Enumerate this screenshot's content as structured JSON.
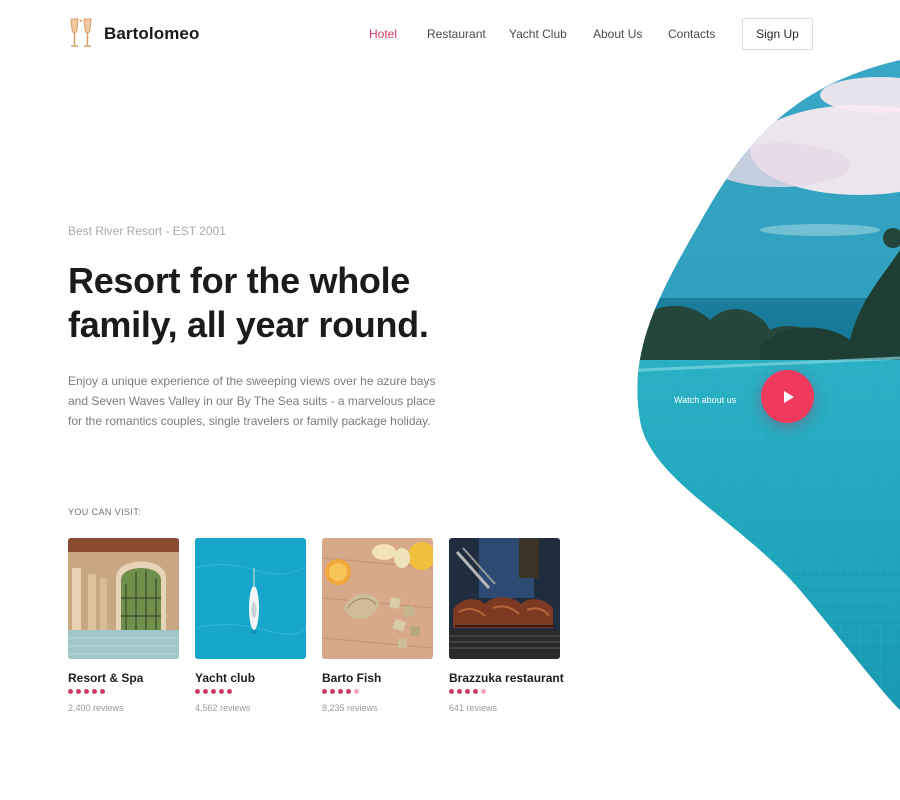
{
  "brand": {
    "name": "Bartolomeo"
  },
  "nav": {
    "items": [
      {
        "label": "Hotel",
        "active": true
      },
      {
        "label": "Restaurant",
        "active": false
      },
      {
        "label": "Yacht Club",
        "active": false
      },
      {
        "label": "About Us",
        "active": false
      },
      {
        "label": "Contacts",
        "active": false
      }
    ],
    "signup_label": "Sign Up"
  },
  "hero": {
    "eyebrow": "Best River Resort - EST 2001",
    "headline_lines": [
      "Resort for the whole",
      "family, all year round."
    ],
    "lead_lines": [
      "Enjoy a unique experience of the sweeping views over he azure bays",
      "and Seven Waves Valley in our By The Sea suits - a marvelous place",
      "for the romantics couples, single travelers or family package holiday."
    ],
    "watch_label": "Watch about us",
    "play_icon": "play-icon"
  },
  "visit": {
    "label": "YOU CAN VISIT:",
    "cards": [
      {
        "title": "Resort & Spa",
        "rating": 5,
        "reviews": "2,400 reviews",
        "image": "resort-spa-photo"
      },
      {
        "title": "Yacht club",
        "rating": 5,
        "reviews": "4,562 reviews",
        "image": "yacht-photo"
      },
      {
        "title": "Barto Fish",
        "rating": 4,
        "reviews": "8,235 reviews",
        "image": "fish-dish-photo"
      },
      {
        "title": "Brazzuka restaurant",
        "rating": 4,
        "reviews": "641 reviews",
        "image": "grill-photo"
      }
    ]
  },
  "colors": {
    "accent": "#d33a63",
    "play_button": "#ef3a5d",
    "star": "#cf3b63",
    "pool": "#1fa3b4"
  }
}
